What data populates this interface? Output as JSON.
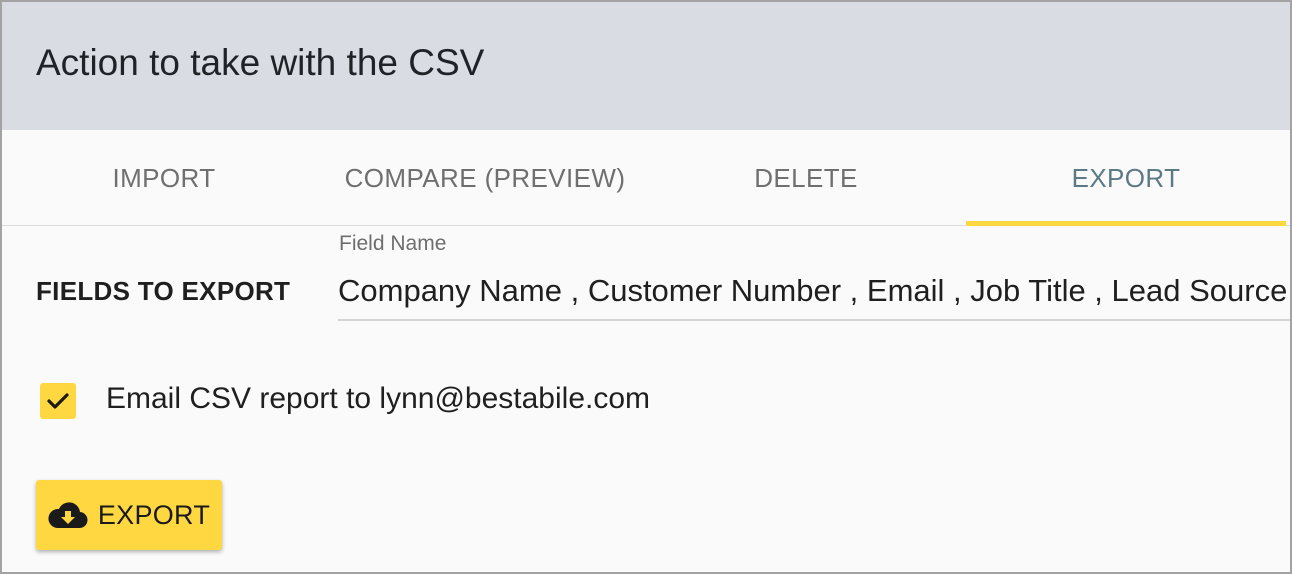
{
  "header": {
    "title": "Action to take with the CSV"
  },
  "tabs": [
    {
      "label": "IMPORT"
    },
    {
      "label": "COMPARE (PREVIEW)"
    },
    {
      "label": "DELETE"
    },
    {
      "label": "EXPORT",
      "active": true
    }
  ],
  "fields": {
    "section_label": "FIELDS TO EXPORT",
    "caption": "Field Name",
    "value": "Company Name , Customer Number , Email , Job Title , Lead Source"
  },
  "email_option": {
    "checked": true,
    "label": "Email CSV report to lynn@bestabile.com"
  },
  "export_button": {
    "label": "EXPORT",
    "icon": "cloud-download-icon"
  },
  "colors": {
    "accent": "#ffd740",
    "header_bg": "#d9dde3",
    "active_tab_text": "#5b7a86"
  }
}
